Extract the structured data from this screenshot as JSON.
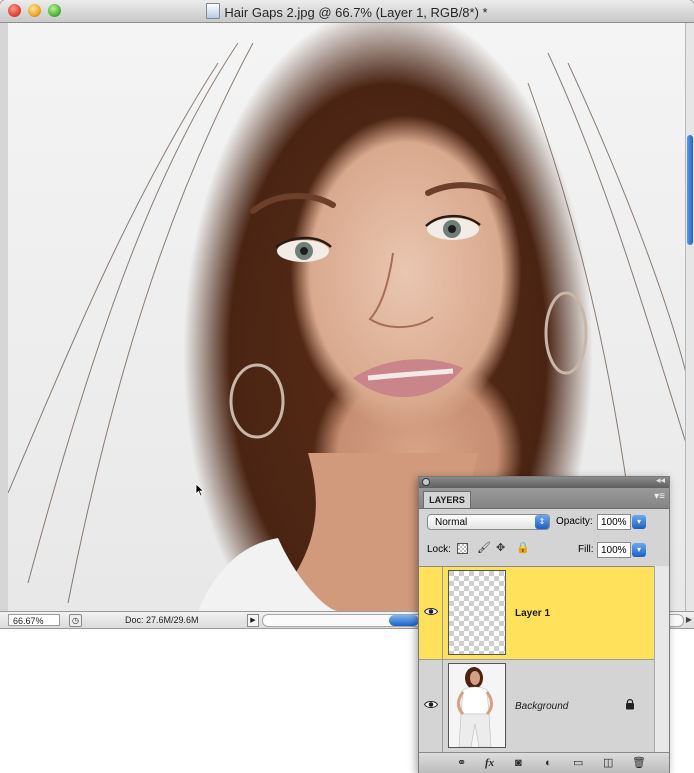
{
  "window": {
    "title": "Hair Gaps 2.jpg @ 66.7% (Layer 1, RGB/8*) *"
  },
  "status": {
    "zoom": "66.67%",
    "doc_size": "Doc: 27.6M/29.6M"
  },
  "layers_panel": {
    "tab_label": "LAYERS",
    "blend_mode": "Normal",
    "opacity_label": "Opacity:",
    "opacity_value": "100%",
    "lock_label": "Lock:",
    "fill_label": "Fill:",
    "fill_value": "100%",
    "layers": [
      {
        "name": "Layer 1",
        "selected": true,
        "visible": true,
        "locked": false
      },
      {
        "name": "Background",
        "selected": false,
        "visible": true,
        "locked": true
      }
    ],
    "bottom_icons": [
      "link-icon",
      "fx-icon",
      "mask-icon",
      "adjustment-icon",
      "folder-icon",
      "new-layer-icon",
      "trash-icon"
    ]
  },
  "colors": {
    "selected_layer": "#ffe15b",
    "accent_blue": "#1d5fc2"
  }
}
